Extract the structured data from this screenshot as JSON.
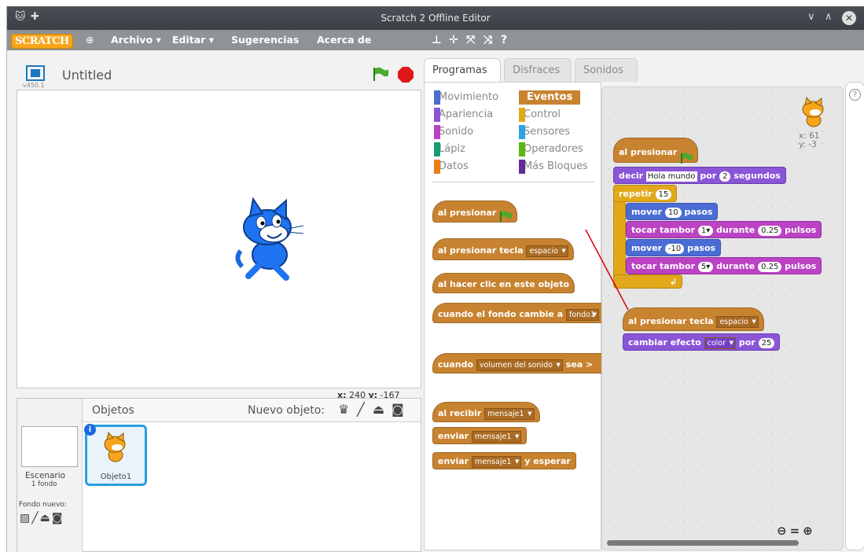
{
  "window": {
    "title": "Scratch 2 Offline Editor"
  },
  "menu": {
    "logo": "SCRATCH",
    "archivo": "Archivo ▾",
    "editar": "Editar ▾",
    "sugerencias": "Sugerencias",
    "acerca": "Acerca de"
  },
  "stage": {
    "title": "Untitled",
    "version": "v450.1",
    "x_label": "x:",
    "x_value": "240",
    "y_label": "y:",
    "y_value": "-167"
  },
  "sprites": {
    "objetos": "Objetos",
    "nuevo_objeto": "Nuevo objeto:",
    "escenario": "Escenario",
    "fondos": "1 fondo",
    "fondo_nuevo": "Fondo nuevo:",
    "sprite_name": "Objeto1"
  },
  "tabs": {
    "programas": "Programas",
    "disfraces": "Disfraces",
    "sonidos": "Sonidos"
  },
  "categories": {
    "movimiento": "Movimiento",
    "apariencia": "Apariencia",
    "sonido": "Sonido",
    "lapiz": "Lápiz",
    "datos": "Datos",
    "eventos": "Eventos",
    "control": "Control",
    "sensores": "Sensores",
    "operadores": "Operadores",
    "mas": "Más Bloques"
  },
  "palette": {
    "al_presionar": "al presionar",
    "al_presionar_tecla": "al presionar tecla",
    "espacio": "espacio",
    "al_hacer_clic": "al hacer clic en este objeto",
    "cuando_fondo": "cuando el fondo cambie a",
    "fondo1": "fondo1",
    "cuando": "cuando",
    "volumen": "volumen del sonido",
    "sea": "sea >",
    "al_recibir": "al recibir",
    "mensaje1": "mensaje1",
    "enviar": "enviar",
    "y_esperar": "y esperar"
  },
  "scripts": {
    "sprite_x": "x: 61",
    "sprite_y": "y: -3",
    "al_presionar": "al presionar",
    "decir": "decir",
    "hola": "Hola mundo",
    "por": "por",
    "dos": "2",
    "segundos": "segundos",
    "repetir": "repetir",
    "quince": "15",
    "mover": "mover",
    "diez": "10",
    "pasos": "pasos",
    "tocar": "tocar tambor",
    "uno": "1",
    "durante": "durante",
    "pulsos_val": "0.25",
    "pulsos": "pulsos",
    "menos_diez": "-10",
    "cinco": "5",
    "tecla": "al presionar tecla",
    "espacio": "espacio",
    "cambiar": "cambiar efecto",
    "color": "color",
    "por2": "por",
    "veinticinco": "25"
  },
  "colors": {
    "eventos": "#c88330",
    "apariencia": "#8a55d7",
    "movimiento": "#4a6cd4",
    "sonido": "#bb42c3",
    "control": "#e1a91a"
  }
}
